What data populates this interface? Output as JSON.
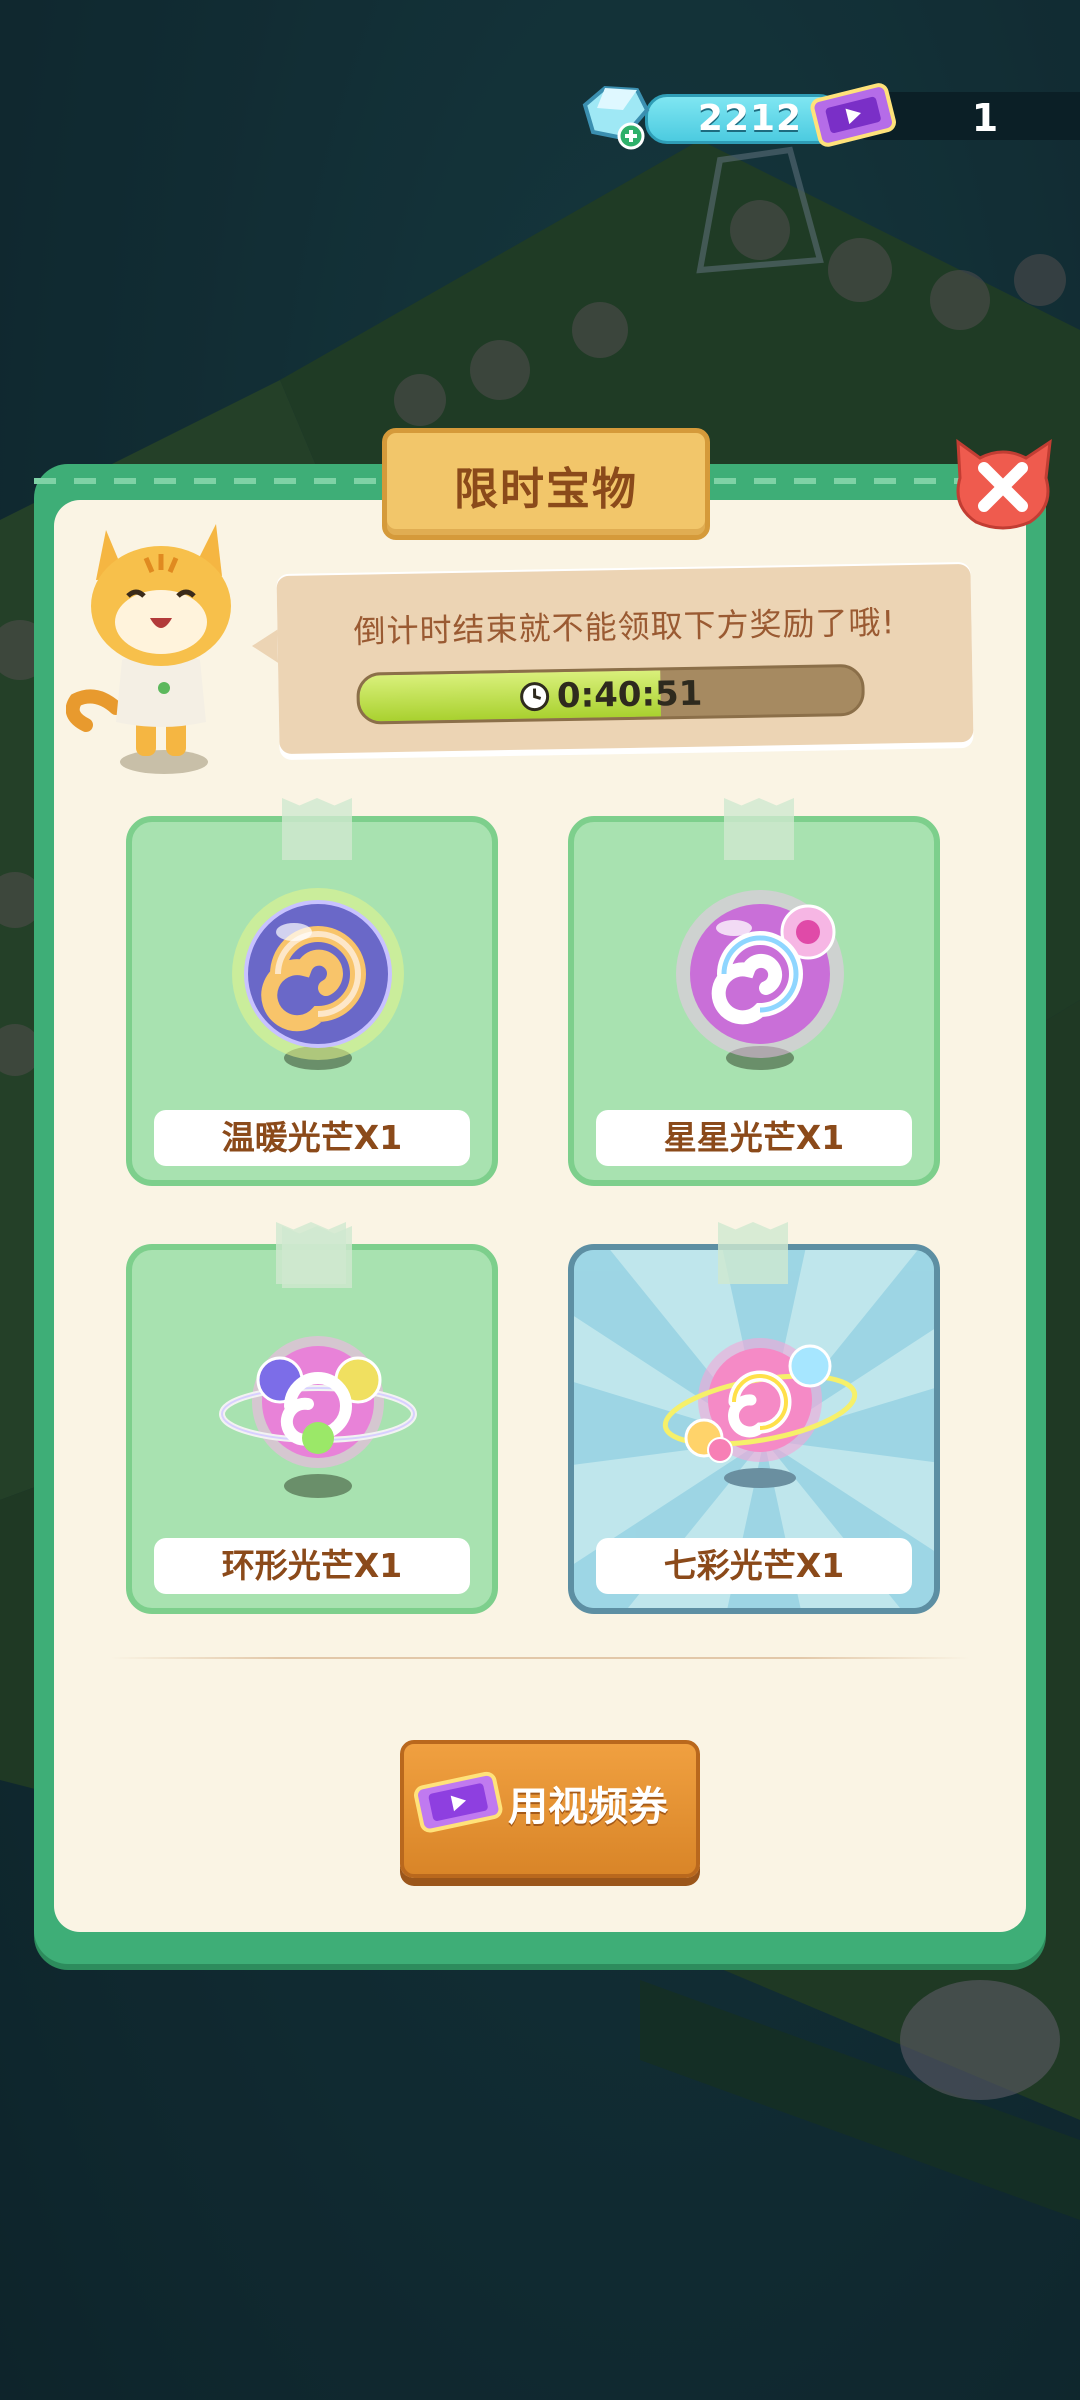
{
  "currency": {
    "gems": "2212",
    "tickets": "1"
  },
  "dialog": {
    "title": "限时宝物",
    "message": "倒计时结束就不能领取下方奖励了哦!",
    "timer": "0:40:51",
    "timer_progress": 0.6
  },
  "rewards": [
    {
      "label": "温暖光芒X1",
      "icon": "warm-glow-orb-icon"
    },
    {
      "label": "星星光芒X1",
      "icon": "star-glow-orb-icon"
    },
    {
      "label": "环形光芒X1",
      "icon": "ring-glow-orb-icon"
    },
    {
      "label": "七彩光芒X1",
      "icon": "rainbow-glow-orb-icon"
    }
  ],
  "actions": {
    "video_button_label": "用视频券"
  },
  "colors": {
    "accent_green": "#3eae77",
    "title_gold": "#f2c66a",
    "button_orange": "#e8943a"
  }
}
